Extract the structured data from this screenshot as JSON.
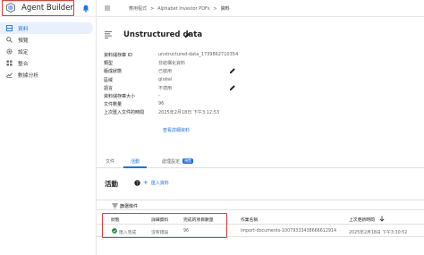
{
  "app": {
    "title": "Agent Builder"
  },
  "sidebar": {
    "items": [
      {
        "label": "資料",
        "icon": "database-icon",
        "active": true
      },
      {
        "label": "預覽",
        "icon": "search-icon",
        "active": false
      },
      {
        "label": "設定",
        "icon": "gear-icon",
        "active": false
      },
      {
        "label": "整合",
        "icon": "grid-icon",
        "active": false
      },
      {
        "label": "數據分析",
        "icon": "chart-icon",
        "active": false
      }
    ]
  },
  "breadcrumb": {
    "items": [
      "應用程式",
      "Alphabet Investor PDFs",
      "資料"
    ],
    "separator": ">"
  },
  "page": {
    "title": "Unstructured data"
  },
  "details": {
    "rows": [
      {
        "label": "資料儲存庫 ID",
        "value": "unstructured-data_1739862710354"
      },
      {
        "label": "類型",
        "value": "非結構化資料"
      },
      {
        "label": "版成狀態",
        "value": "已啟用"
      },
      {
        "label": "區域",
        "value": "global"
      },
      {
        "label": "語言",
        "value": "不適用"
      },
      {
        "label": "資料儲存庫大小",
        "value": "-"
      },
      {
        "label": "文件數量",
        "value": "96"
      },
      {
        "label": "上次匯入文件的時間",
        "value": "2025年2月18日 下午3:12:53"
      }
    ],
    "view_link": "查看詳細資料"
  },
  "tabs": [
    {
      "label": "文件",
      "active": false
    },
    {
      "label": "活動",
      "active": true
    },
    {
      "label": "處理設定",
      "active": false,
      "badge": "預覽"
    }
  ],
  "activity": {
    "title": "活動",
    "import_button": "匯入資料",
    "filter_label": "篩選條件",
    "columns": [
      "狀態",
      "詳細資料",
      "完成的項目數量",
      "作業名稱",
      "上次更新時間"
    ],
    "rows": [
      {
        "status": "匯入完成",
        "detail": "沒有錯誤",
        "count": "96",
        "job": "import-documents-10079333438666612914",
        "updated": "2025年2月18日 下午3:30:52"
      }
    ]
  },
  "colors": {
    "accent": "#1a73e8",
    "highlight": "#e53935",
    "success": "#188038"
  }
}
